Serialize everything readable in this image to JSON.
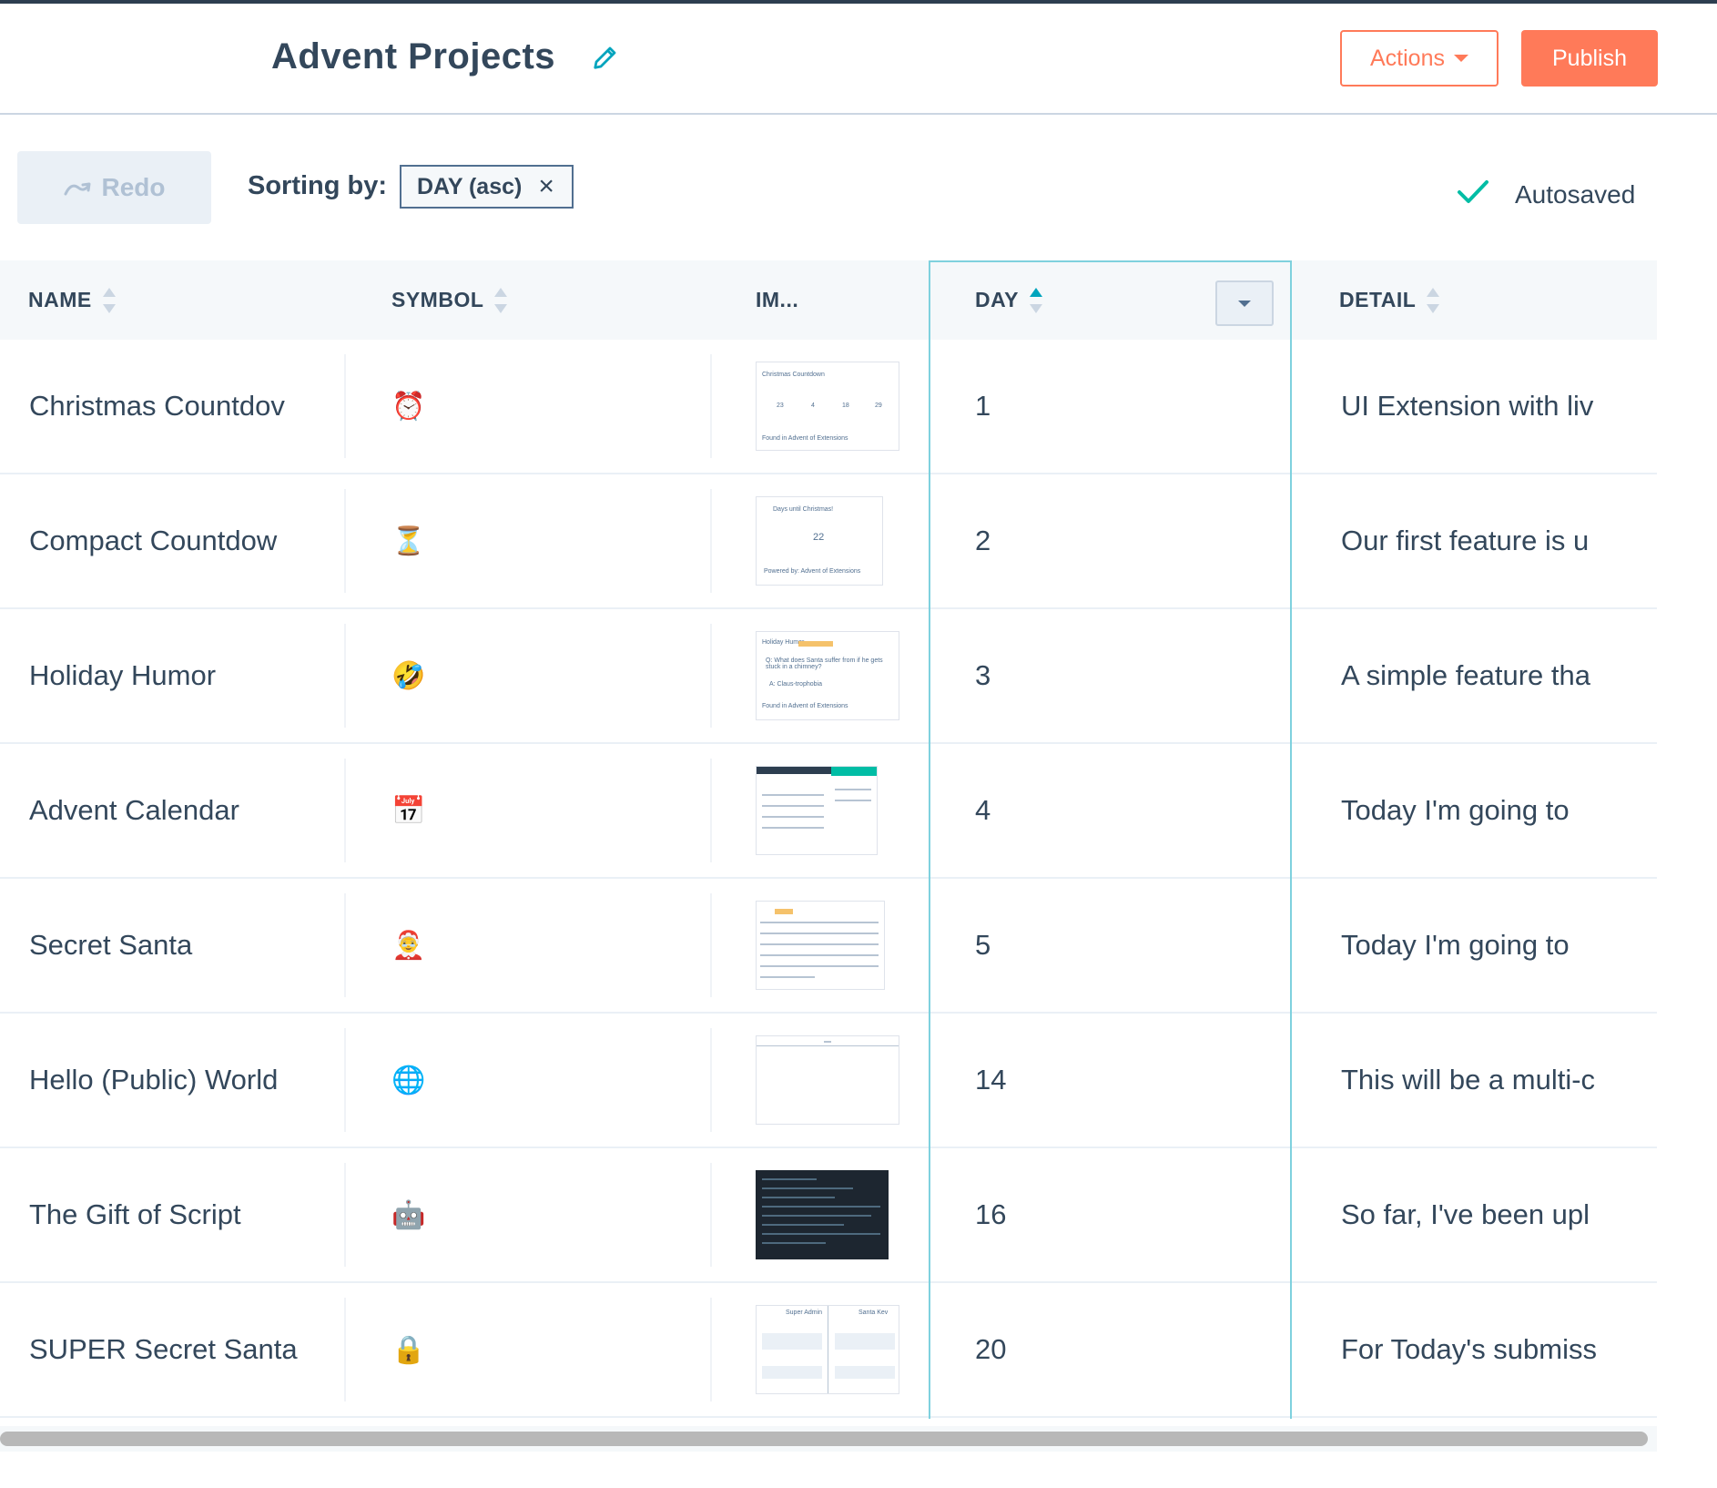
{
  "header": {
    "title": "Advent Projects",
    "edit_icon": "pencil-icon",
    "actions_label": "Actions",
    "publish_label": "Publish"
  },
  "toolbar": {
    "redo_label": "Redo",
    "sorting_label": "Sorting by:",
    "sort_chip": "DAY (asc)",
    "autosave_label": "Autosaved"
  },
  "colors": {
    "accent": "#ff7a59",
    "teal": "#00a4bd",
    "success": "#00bda5",
    "text": "#33475b"
  },
  "table": {
    "columns": [
      "NAME",
      "SYMBOL",
      "IM...",
      "DAY",
      "DETAIL"
    ],
    "rows": [
      {
        "name": "Christmas Countdov",
        "symbol": "⏰",
        "day": "1",
        "detail": "UI Extension with liv"
      },
      {
        "name": "Compact Countdow",
        "symbol": "⏳",
        "day": "2",
        "detail": "Our first feature is u"
      },
      {
        "name": "Holiday Humor",
        "symbol": "🤣",
        "day": "3",
        "detail": "A simple feature tha"
      },
      {
        "name": "Advent Calendar",
        "symbol": "📅",
        "day": "4",
        "detail": "Today I'm going to"
      },
      {
        "name": "Secret Santa",
        "symbol": "🤶",
        "day": "5",
        "detail": "Today I'm going to"
      },
      {
        "name": "Hello (Public) World",
        "symbol": "🌐",
        "day": "14",
        "detail": "This will be a multi-c"
      },
      {
        "name": "The Gift of Script",
        "symbol": "🤖",
        "day": "16",
        "detail": "So far, I've been upl"
      },
      {
        "name": "SUPER Secret Santa",
        "symbol": "🔒",
        "day": "20",
        "detail": "For Today's submiss"
      }
    ]
  },
  "thumbnails": {
    "t1": {
      "title": "Christmas Countdown",
      "nums": [
        "23",
        "4",
        "18",
        "29"
      ],
      "foot": "Found in Advent of Extensions"
    },
    "t2": {
      "title": "Days until Christmas!",
      "num": "22",
      "foot": "Powered by: Advent of Extensions"
    },
    "t3": {
      "title": "Holiday Humor",
      "q": "Q: What does Santa suffer from if he gets stuck in a chimney?",
      "a": "A: Claus-trophobia",
      "foot": "Found in Advent of Extensions"
    },
    "t8": {
      "left": "Super Admin",
      "right": "Santa Kev"
    }
  }
}
